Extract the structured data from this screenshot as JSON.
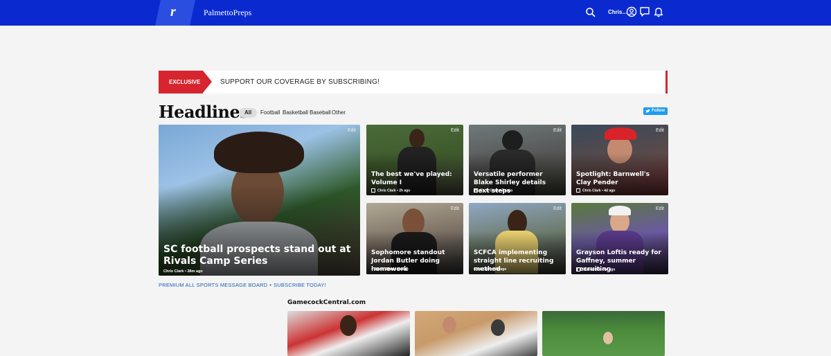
{
  "header": {
    "logo_letter": "r",
    "site_name": "PalmettoPreps",
    "user_name": "Chris...",
    "icons": [
      "search-icon",
      "user-circle-icon",
      "message-icon",
      "bell-icon"
    ]
  },
  "banner": {
    "tag": "EXCLUSIVE",
    "text": "SUPPORT OUR COVERAGE BY SUBSCRIBING!"
  },
  "headlines": {
    "title": "Headlines",
    "filters": [
      "All",
      "Football",
      "Basketball",
      "Baseball",
      "Other"
    ],
    "active_filter": "All",
    "follow_label": "Follow"
  },
  "cards": [
    {
      "title": "SC football prospects stand out at Rivals Camp Series",
      "author": "Chris Clark",
      "age": "38m ago",
      "edit": "Edit"
    },
    {
      "title": "The best we've played: Volume I",
      "author": "Chris Clark",
      "age": "2h ago",
      "edit": "Edit"
    },
    {
      "title": "Versatile performer Blake Shirley details next steps",
      "author": "Chris Clark",
      "age": "7h ago",
      "edit": "Edit"
    },
    {
      "title": "Spotlight: Barnwell's Clay Pender",
      "author": "Chris Clark",
      "age": "4d ago",
      "edit": "Edit"
    },
    {
      "title": "Sophomore standout Jordan Butler doing homework",
      "author": "Jamie Shaw",
      "age": "2h ago",
      "edit": "Edit"
    },
    {
      "title": "SCFCA implementing straight line recruiting method",
      "author": "Chris Clark",
      "age": "4d ago",
      "edit": "Edit"
    },
    {
      "title": "Grayson Loftis ready for Gaffney, summer recruiting",
      "author": "Chris Clark",
      "age": "5d ago",
      "edit": "Edit"
    }
  ],
  "links": {
    "message_board": "PREMIUM ALL SPORTS MESSAGE BOARD",
    "separator": "•",
    "subscribe": "SUBSCRIBE TODAY!"
  },
  "network": {
    "title": "GamecockCentral.com"
  },
  "colors": {
    "header_bg": "#0a2ad0",
    "accent_red": "#d6252f",
    "link_blue": "#1a5fb4",
    "twitter_blue": "#1d9bf0"
  }
}
